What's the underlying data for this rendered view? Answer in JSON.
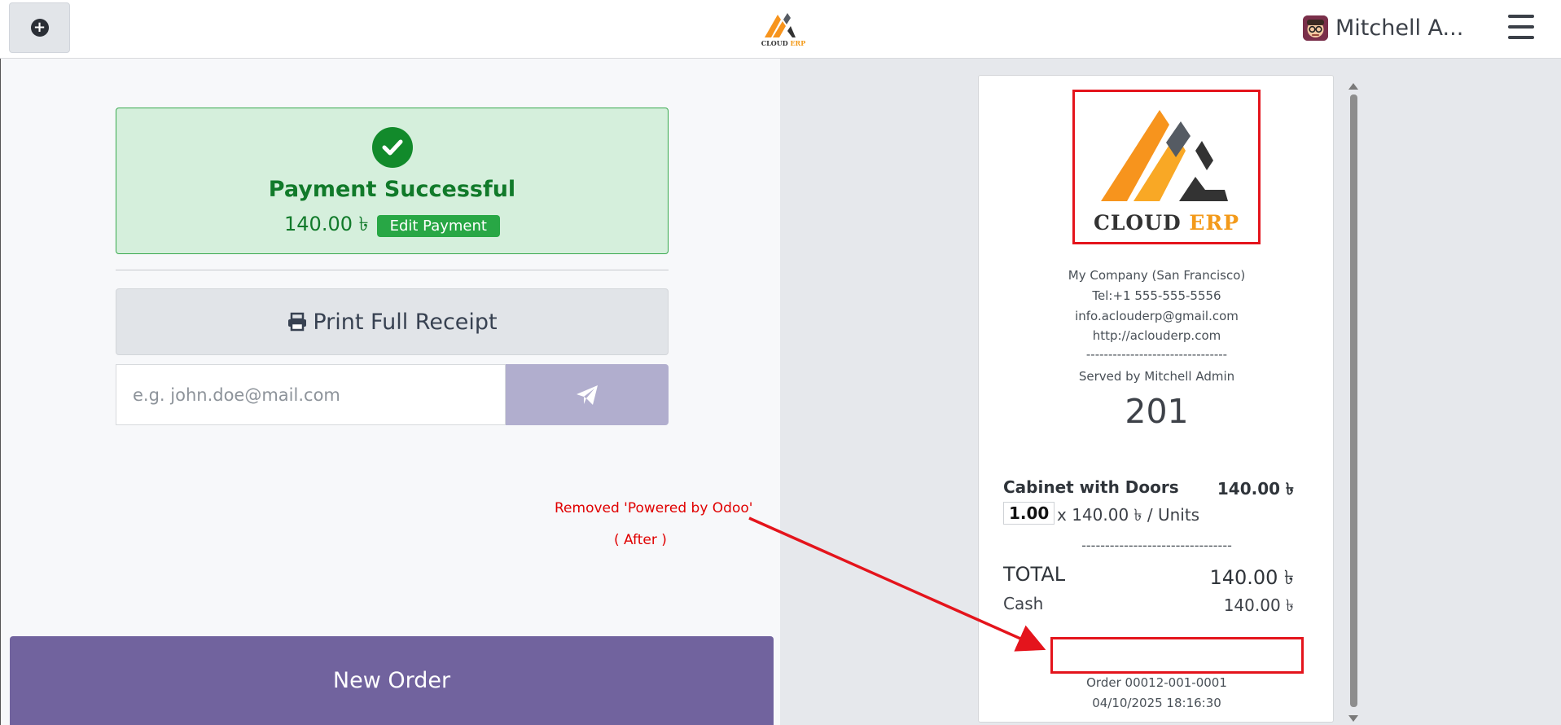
{
  "navbar": {
    "user_name": "Mitchell A...",
    "add_icon": "plus-circle-icon",
    "menu_icon": "hamburger-menu-icon"
  },
  "payment": {
    "status_title": "Payment Successful",
    "amount": "140.00 ৳",
    "edit_label": "Edit Payment"
  },
  "actions": {
    "print_label": "Print Full Receipt",
    "email_placeholder": "e.g. john.doe@mail.com",
    "new_order_label": "New Order"
  },
  "annotation": {
    "line1": "Removed 'Powered by Odoo'",
    "line2": "( After )",
    "color": "#e00000"
  },
  "receipt": {
    "logo_word1": "CLOUD",
    "logo_word2": "ERP",
    "company": "My Company (San Francisco)",
    "tel": "Tel:+1 555-555-5556",
    "email": "info.aclouderp@gmail.com",
    "website": "http://aclouderp.com",
    "dashes": "--------------------------------",
    "served_by": "Served by Mitchell Admin",
    "tracking_number": "201",
    "product_name": "Cabinet with Doors",
    "product_price": "140.00 ৳",
    "quantity": "1.00",
    "unit_line": "x 140.00 ৳ / Units",
    "dashes2": "--------------------------------",
    "total_label": "TOTAL",
    "total_value": "140.00 ৳",
    "cash_label": "Cash",
    "cash_value": "140.00 ৳",
    "order_ref": "Order 00012-001-0001",
    "order_date": "04/10/2025 18:16:30"
  },
  "colors": {
    "success_bg": "#d5efdc",
    "success_text": "#117a2a",
    "primary": "#71639e",
    "annotation_red": "#e4141c"
  }
}
